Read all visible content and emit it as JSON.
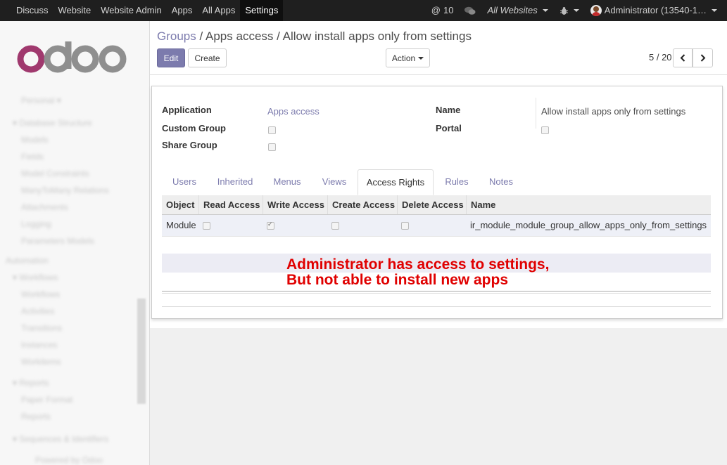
{
  "topbar": {
    "menu": [
      "Discuss",
      "Website",
      "Website Admin",
      "Apps",
      "All Apps",
      "Settings"
    ],
    "active_menu": "Settings",
    "mentions_count": "10",
    "website_selector": "All Websites",
    "user": "Administrator (13540-1…"
  },
  "sidebar": {
    "logo_text": "odoo",
    "logo_colors": {
      "o": "#a0396e",
      "rest": "#8f8f8f"
    }
  },
  "breadcrumb": {
    "root": "Groups",
    "sep": "/",
    "current": "Apps access / Allow install apps only from settings"
  },
  "buttons": {
    "edit": "Edit",
    "create": "Create",
    "action": "Action"
  },
  "pager": {
    "text": "5 / 20"
  },
  "form": {
    "application_label": "Application",
    "application_value": "Apps access",
    "custom_group_label": "Custom Group",
    "share_group_label": "Share Group",
    "name_label": "Name",
    "name_value": "Allow install apps only from settings",
    "portal_label": "Portal"
  },
  "tabs": [
    "Users",
    "Inherited",
    "Menus",
    "Views",
    "Access Rights",
    "Rules",
    "Notes"
  ],
  "active_tab": "Access Rights",
  "grid": {
    "columns": [
      "Object",
      "Read Access",
      "Write Access",
      "Create Access",
      "Delete Access",
      "Name"
    ],
    "rows": [
      {
        "object": "Module",
        "read": false,
        "write": true,
        "create": false,
        "delete": false,
        "name": "ir_module_module_group_allow_apps_only_from_settings"
      }
    ]
  },
  "annotation": {
    "line1": "Administrator has access to settings,",
    "line2": "But not able to install new apps",
    "color": "#e00000"
  },
  "colors": {
    "accent": "#7c7bad",
    "topbar": "#1f1f1f"
  }
}
